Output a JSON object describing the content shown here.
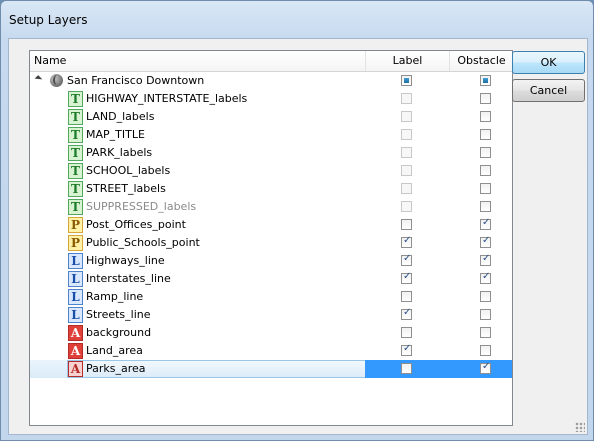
{
  "window": {
    "title": "Setup Layers"
  },
  "columns": {
    "name": "Name",
    "label": "Label",
    "obstacle": "Obstacle"
  },
  "root": {
    "name": "San Francisco Downtown",
    "label": "partial",
    "obstacle": "partial"
  },
  "layers": [
    {
      "icon": "T",
      "name": "HIGHWAY_INTERSTATE_labels",
      "label": "disabled",
      "obstacle": "unchecked",
      "dim": false
    },
    {
      "icon": "T",
      "name": "LAND_labels",
      "label": "disabled",
      "obstacle": "unchecked",
      "dim": false
    },
    {
      "icon": "T",
      "name": "MAP_TITLE",
      "label": "disabled",
      "obstacle": "unchecked",
      "dim": false
    },
    {
      "icon": "T",
      "name": "PARK_labels",
      "label": "disabled",
      "obstacle": "unchecked",
      "dim": false
    },
    {
      "icon": "T",
      "name": "SCHOOL_labels",
      "label": "disabled",
      "obstacle": "unchecked",
      "dim": false
    },
    {
      "icon": "T",
      "name": "STREET_labels",
      "label": "disabled",
      "obstacle": "unchecked",
      "dim": false
    },
    {
      "icon": "T",
      "name": "SUPPRESSED_labels",
      "label": "disabled",
      "obstacle": "unchecked",
      "dim": true
    },
    {
      "icon": "P",
      "name": "Post_Offices_point",
      "label": "unchecked",
      "obstacle": "checked",
      "dim": false
    },
    {
      "icon": "P",
      "name": "Public_Schools_point",
      "label": "checked",
      "obstacle": "checked",
      "dim": false
    },
    {
      "icon": "L",
      "name": "Highways_line",
      "label": "checked",
      "obstacle": "checked",
      "dim": false
    },
    {
      "icon": "L",
      "name": "Interstates_line",
      "label": "checked",
      "obstacle": "checked",
      "dim": false
    },
    {
      "icon": "L",
      "name": "Ramp_line",
      "label": "unchecked",
      "obstacle": "unchecked",
      "dim": false
    },
    {
      "icon": "L",
      "name": "Streets_line",
      "label": "checked",
      "obstacle": "unchecked",
      "dim": false
    },
    {
      "icon": "A",
      "name": "background",
      "label": "unchecked",
      "obstacle": "unchecked",
      "dim": false
    },
    {
      "icon": "A",
      "name": "Land_area",
      "label": "checked",
      "obstacle": "unchecked",
      "dim": false
    },
    {
      "icon": "A",
      "name": "Parks_area",
      "label": "unchecked",
      "obstacle": "checked",
      "dim": false,
      "selected": true
    }
  ],
  "buttons": {
    "ok": "OK",
    "cancel": "Cancel"
  },
  "icons": {
    "root": "globe-icon",
    "expander": "expander-arrow-icon",
    "T": "text-layer-icon",
    "P": "point-layer-icon",
    "L": "line-layer-icon",
    "A": "area-layer-icon",
    "grip": "resize-grip-icon"
  },
  "colors": {
    "selection": "#3399ff",
    "window_frame": "#c6d9ee"
  }
}
